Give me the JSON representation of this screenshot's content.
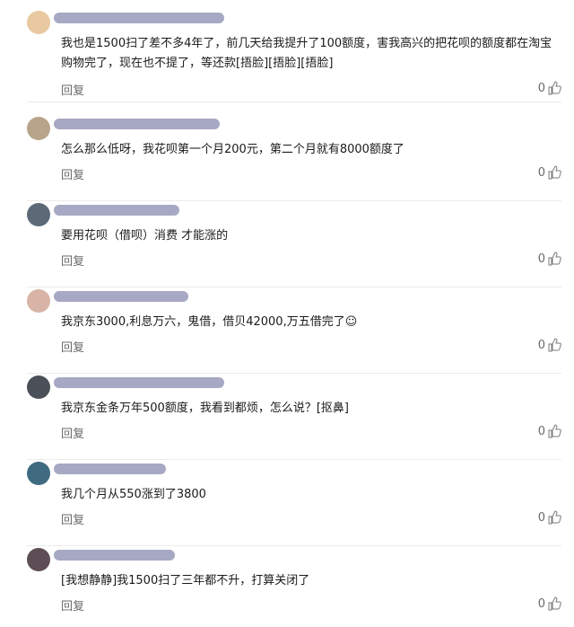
{
  "comments": [
    {
      "text": "我也是1500扫了差不多4年了，前几天给我提升了100额度，害我高兴的把花呗的额度都在淘宝购物完了，现在也不提了，等还款[捂脸][捂脸][捂脸]",
      "reply": "回复",
      "likes": "0",
      "avatar_color": "#e9c9a0"
    },
    {
      "text": "怎么那么低呀，我花呗第一个月200元，第二个月就有8000额度了",
      "reply": "回复",
      "likes": "0",
      "avatar_color": "#b7a48a"
    },
    {
      "text": "要用花呗（借呗）消费 才能涨的",
      "reply": "回复",
      "likes": "0",
      "avatar_color": "#5c6a78"
    },
    {
      "text": "我京东3000,利息万六，鬼借，借贝42000,万五借完了☺",
      "reply": "回复",
      "likes": "0",
      "avatar_color": "#d7b4a6"
    },
    {
      "text": "我京东金条万年500额度，我看到都烦，怎么说？[抠鼻]",
      "reply": "回复",
      "likes": "0",
      "avatar_color": "#4a4f58"
    },
    {
      "text": "我几个月从550涨到了3800",
      "reply": "回复",
      "likes": "0",
      "avatar_color": "#3f6a80"
    },
    {
      "text": "[我想静静]我1500扫了三年都不升，打算关闭了",
      "reply": "回复",
      "likes": "0",
      "avatar_color": "#5d4d55"
    }
  ]
}
